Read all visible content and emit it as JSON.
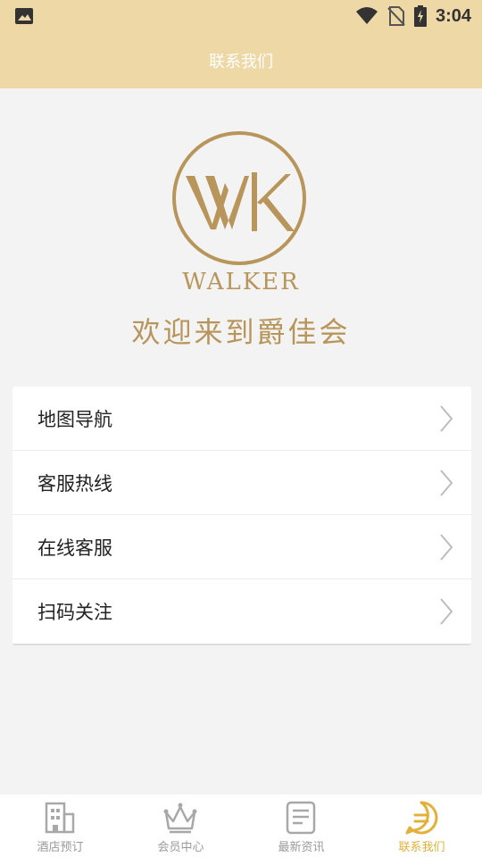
{
  "status_bar": {
    "time": "3:04",
    "icons": [
      "image-icon",
      "wifi-icon",
      "no-sim-icon",
      "battery-charging-icon"
    ]
  },
  "header": {
    "title": "联系我们"
  },
  "brand": {
    "logo_monogram": "WK",
    "name": "WALKER",
    "welcome": "欢迎来到爵佳会"
  },
  "menu": {
    "items": [
      {
        "label": "地图导航",
        "icon": "chevron-right-icon"
      },
      {
        "label": "客服热线",
        "icon": "chevron-right-icon"
      },
      {
        "label": "在线客服",
        "icon": "chevron-right-icon"
      },
      {
        "label": "扫码关注",
        "icon": "chevron-right-icon"
      }
    ]
  },
  "tabbar": {
    "tabs": [
      {
        "label": "酒店预订",
        "icon": "building-icon",
        "active": false
      },
      {
        "label": "会员中心",
        "icon": "crown-icon",
        "active": false
      },
      {
        "label": "最新资讯",
        "icon": "news-icon",
        "active": false
      },
      {
        "label": "联系我们",
        "icon": "chat-icon",
        "active": true
      }
    ]
  },
  "colors": {
    "header_bg": "#eed8a5",
    "gold": "#b8955a",
    "active_tab": "#e3b13a",
    "inactive_tab": "#9a9a9a",
    "page_bg": "#f3f3f3"
  }
}
